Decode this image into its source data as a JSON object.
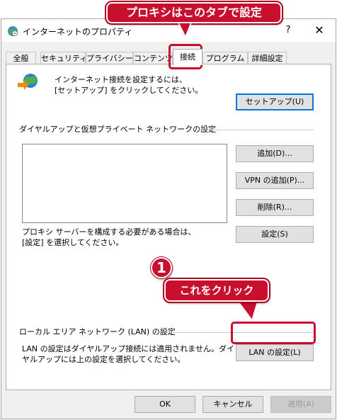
{
  "window": {
    "title": "インターネットのプロパティ",
    "help": "?",
    "close": "✕"
  },
  "tabs": [
    "全般",
    "セキュリティ",
    "プライバシー",
    "コンテンツ",
    "接続",
    "プログラム",
    "詳細設定"
  ],
  "active_tab": "接続",
  "setup": {
    "text_line1": "インターネット接続を設定するには、",
    "text_line2": "[セットアップ] をクリックしてください。",
    "button": "セットアップ(U)"
  },
  "dialup": {
    "heading": "ダイヤルアップと仮想プライベート ネットワークの設定",
    "add_button": "追加(D)...",
    "add_vpn_button": "VPN の追加(P)...",
    "remove_button": "削除(R)...",
    "settings_button": "設定(S)",
    "proxy_text_line1": "プロキシ サーバーを構成する必要がある場合は、",
    "proxy_text_line2": "[設定] を選択してください。"
  },
  "lan": {
    "heading": "ローカル エリア ネットワーク (LAN) の設定",
    "text_line1": "LAN の設定はダイヤルアップ接続には適用されません。ダイ",
    "text_line2": "ヤルアップには上の設定を選択してください。",
    "button": "LAN の設定(L)"
  },
  "footer": {
    "ok": "OK",
    "cancel": "キャンセル",
    "apply": "適用(A)"
  },
  "annotations": {
    "top_callout": "プロキシはこのタブで設定",
    "step_number": "1",
    "step_callout": "これをクリック",
    "accent_color": "#c8102e"
  }
}
